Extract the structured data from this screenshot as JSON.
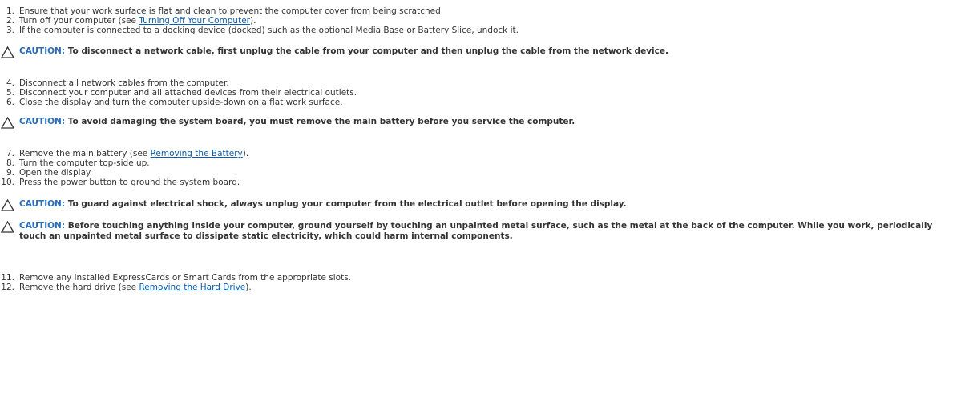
{
  "steps": [
    {
      "n": "1.",
      "pre": "Ensure that your work surface is flat and clean to prevent the computer cover from being scratched.",
      "link": "",
      "post": ""
    },
    {
      "n": "2.",
      "pre": "Turn off your computer (see ",
      "link": "Turning Off Your Computer",
      "post": ")."
    },
    {
      "n": "3.",
      "pre": "If the computer is connected to a docking device (docked) such as the optional Media Base or Battery Slice, undock it.",
      "link": "",
      "post": ""
    },
    {
      "n": "4.",
      "pre": "Disconnect all network cables from the computer.",
      "link": "",
      "post": ""
    },
    {
      "n": "5.",
      "pre": "Disconnect your computer and all attached devices from their electrical outlets.",
      "link": "",
      "post": ""
    },
    {
      "n": "6.",
      "pre": "Close the display and turn the computer upside-down on a flat work surface.",
      "link": "",
      "post": ""
    },
    {
      "n": "7.",
      "pre": "Remove the main battery (see ",
      "link": "Removing the Battery",
      "post": ")."
    },
    {
      "n": "8.",
      "pre": "Turn the computer top-side up.",
      "link": "",
      "post": ""
    },
    {
      "n": "9.",
      "pre": "Open the display.",
      "link": "",
      "post": ""
    },
    {
      "n": "10.",
      "pre": "Press the power button to ground the system board.",
      "link": "",
      "post": ""
    },
    {
      "n": "11.",
      "pre": "Remove any installed ExpressCards or Smart Cards from the appropriate slots.",
      "link": "",
      "post": ""
    },
    {
      "n": "12.",
      "pre": "Remove the hard drive (see ",
      "link": "Removing the Hard Drive",
      "post": ")."
    }
  ],
  "cautions": [
    {
      "label": "CAUTION:",
      "text": "To disconnect a network cable, first unplug the cable from your computer and then unplug the cable from the network device."
    },
    {
      "label": "CAUTION:",
      "text": "To avoid damaging the system board, you must remove the main battery before you service the computer."
    },
    {
      "label": "CAUTION:",
      "text": "To guard against electrical shock, always unplug your computer from the electrical outlet before opening the display."
    },
    {
      "label": "CAUTION:",
      "text": "Before touching anything inside your computer, ground yourself by touching an unpainted metal surface, such as the metal at the back of the computer. While you work, periodically touch an unpainted metal surface to dissipate static electricity, which could harm internal components."
    }
  ],
  "icons": {
    "caution": "caution-triangle-icon"
  },
  "colors": {
    "link": "#0b5cad",
    "caution_label": "#2a6ebb",
    "text": "#333333"
  }
}
